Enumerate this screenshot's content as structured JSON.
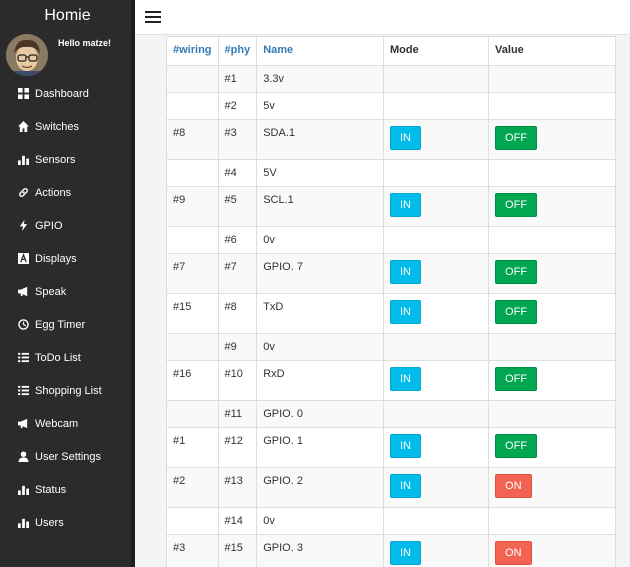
{
  "app": {
    "title": "Homie"
  },
  "user": {
    "greeting": "Hello matze!"
  },
  "sidebar": {
    "items": [
      {
        "label": "Dashboard",
        "icon": "dashboard-icon"
      },
      {
        "label": "Switches",
        "icon": "home-icon"
      },
      {
        "label": "Sensors",
        "icon": "bar-chart-icon"
      },
      {
        "label": "Actions",
        "icon": "link-icon"
      },
      {
        "label": "GPIO",
        "icon": "flash-icon"
      },
      {
        "label": "Displays",
        "icon": "font-icon"
      },
      {
        "label": "Speak",
        "icon": "bullhorn-icon"
      },
      {
        "label": "Egg Timer",
        "icon": "clock-icon"
      },
      {
        "label": "ToDo List",
        "icon": "list-icon"
      },
      {
        "label": "Shopping List",
        "icon": "list-icon"
      },
      {
        "label": "Webcam",
        "icon": "bullhorn-icon"
      },
      {
        "label": "User Settings",
        "icon": "user-icon"
      },
      {
        "label": "Status",
        "icon": "bar-chart-icon"
      },
      {
        "label": "Users",
        "icon": "bar-chart-icon"
      }
    ]
  },
  "table": {
    "headers": {
      "wiring": "#wiring",
      "phy": "#phy",
      "name": "Name",
      "mode": "Mode",
      "value": "Value"
    },
    "rows": [
      {
        "wiring": "",
        "phy": "#1",
        "name": "3.3v",
        "mode": "",
        "value": ""
      },
      {
        "wiring": "",
        "phy": "#2",
        "name": "5v",
        "mode": "",
        "value": ""
      },
      {
        "wiring": "#8",
        "phy": "#3",
        "name": "SDA.1",
        "mode": "IN",
        "value": "OFF"
      },
      {
        "wiring": "",
        "phy": "#4",
        "name": "5V",
        "mode": "",
        "value": ""
      },
      {
        "wiring": "#9",
        "phy": "#5",
        "name": "SCL.1",
        "mode": "IN",
        "value": "OFF"
      },
      {
        "wiring": "",
        "phy": "#6",
        "name": "0v",
        "mode": "",
        "value": ""
      },
      {
        "wiring": "#7",
        "phy": "#7",
        "name": "GPIO. 7",
        "mode": "IN",
        "value": "OFF"
      },
      {
        "wiring": "#15",
        "phy": "#8",
        "name": "TxD",
        "mode": "IN",
        "value": "OFF"
      },
      {
        "wiring": "",
        "phy": "#9",
        "name": "0v",
        "mode": "",
        "value": ""
      },
      {
        "wiring": "#16",
        "phy": "#10",
        "name": "RxD",
        "mode": "IN",
        "value": "OFF"
      },
      {
        "wiring": "",
        "phy": "#11",
        "name": "GPIO. 0",
        "mode": "",
        "value": ""
      },
      {
        "wiring": "#1",
        "phy": "#12",
        "name": "GPIO. 1",
        "mode": "IN",
        "value": "OFF"
      },
      {
        "wiring": "#2",
        "phy": "#13",
        "name": "GPIO. 2",
        "mode": "IN",
        "value": "ON"
      },
      {
        "wiring": "",
        "phy": "#14",
        "name": "0v",
        "mode": "",
        "value": ""
      },
      {
        "wiring": "#3",
        "phy": "#15",
        "name": "GPIO. 3",
        "mode": "IN",
        "value": "ON"
      }
    ]
  },
  "colors": {
    "sidebar": "#2b2b2b",
    "mode_button": "#00bcea",
    "off_button": "#00a650",
    "on_button": "#f26451",
    "link": "#337ab7"
  }
}
